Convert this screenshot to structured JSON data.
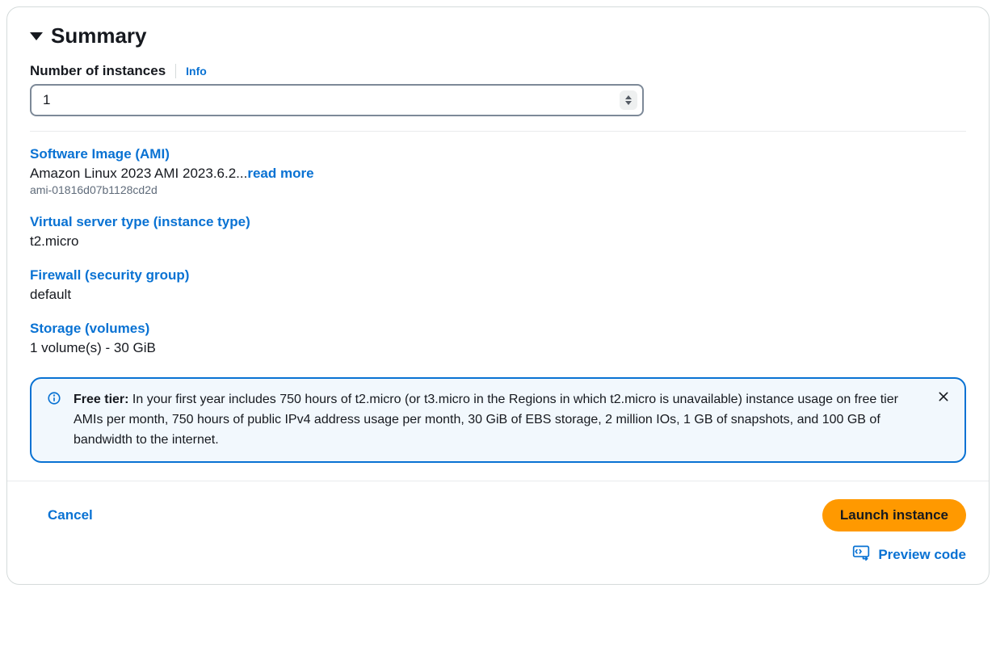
{
  "summary": {
    "title": "Summary",
    "num_instances_label": "Number of instances",
    "info_label": "Info",
    "num_instances_value": "1"
  },
  "ami": {
    "title": "Software Image (AMI)",
    "name": "Amazon Linux 2023 AMI 2023.6.2...",
    "read_more": "read more",
    "id": "ami-01816d07b1128cd2d"
  },
  "instance_type": {
    "title": "Virtual server type (instance type)",
    "value": "t2.micro"
  },
  "firewall": {
    "title": "Firewall (security group)",
    "value": "default"
  },
  "storage": {
    "title": "Storage (volumes)",
    "value": "1 volume(s) - 30 GiB"
  },
  "alert": {
    "prefix": "Free tier:",
    "text": " In your first year includes 750 hours of t2.micro (or t3.micro in the Regions in which t2.micro is unavailable) instance usage on free tier AMIs per month, 750 hours of public IPv4 address usage per month, 30 GiB of EBS storage, 2 million IOs, 1 GB of snapshots, and 100 GB of bandwidth to the internet."
  },
  "footer": {
    "cancel": "Cancel",
    "launch": "Launch instance",
    "preview": "Preview code"
  }
}
